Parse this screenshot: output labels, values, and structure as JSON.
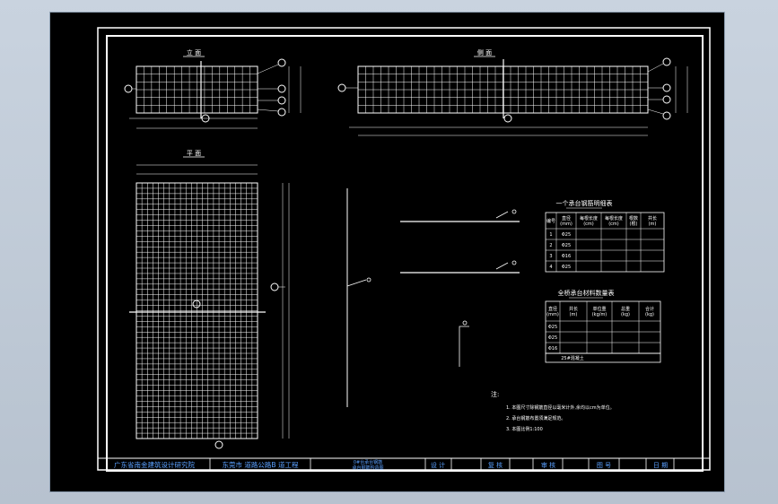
{
  "views": {
    "elevation_title": "立 面",
    "side_title": "侧 面",
    "plan_title": "平 面"
  },
  "rebar_table": {
    "title": "一个承台钢筋明细表",
    "headers": [
      "编号",
      "直径\n(mm)",
      "每根长度\n(cm)",
      "每根长度\n(cm)",
      "根数\n(根)",
      "共长\n(m)"
    ],
    "rows": [
      [
        "1",
        "Φ25",
        "",
        "",
        "",
        ""
      ],
      [
        "2",
        "Φ25",
        "",
        "",
        "",
        ""
      ],
      [
        "3",
        "Φ16",
        "",
        "",
        "",
        ""
      ],
      [
        "4",
        "Φ25",
        "",
        "",
        "",
        ""
      ]
    ]
  },
  "material_table": {
    "title": "全桥承台材料数量表",
    "headers": [
      "直径\n(mm)",
      "共长\n(m)",
      "单位重\n(kg/m)",
      "总重\n(kg)",
      "合计\n(kg)"
    ],
    "rows": [
      [
        "Φ25",
        "",
        "",
        "",
        ""
      ],
      [
        "Φ25",
        "",
        "",
        "",
        ""
      ],
      [
        "Φ16",
        "",
        "",
        "",
        ""
      ]
    ],
    "footer": [
      "25#混凝土",
      "",
      ""
    ]
  },
  "notes": {
    "title": "注:",
    "items": [
      "1.  本图尺寸除钢筋直径以毫米计外,余均以cm为单位。",
      "2.  承台钢筋布置须满足规范。",
      "3.  本图比例1:100"
    ]
  },
  "title_block": {
    "company": "广东省南金建筑设计研究院",
    "project": "东莞市 道路公路B 道工程",
    "drawing_line1": "0#台承台钢筋",
    "drawing_line2": "承台钢筋构造图",
    "design_label": "设 计",
    "review_label": "复 核",
    "approve_label": "审 核",
    "drawing_no_label": "图 号",
    "date_label": "日 期"
  },
  "colors": {
    "background": "#000000",
    "line": "#ffffff",
    "title_text": "#5aa0ff",
    "desktop": "#c2ccd8"
  }
}
